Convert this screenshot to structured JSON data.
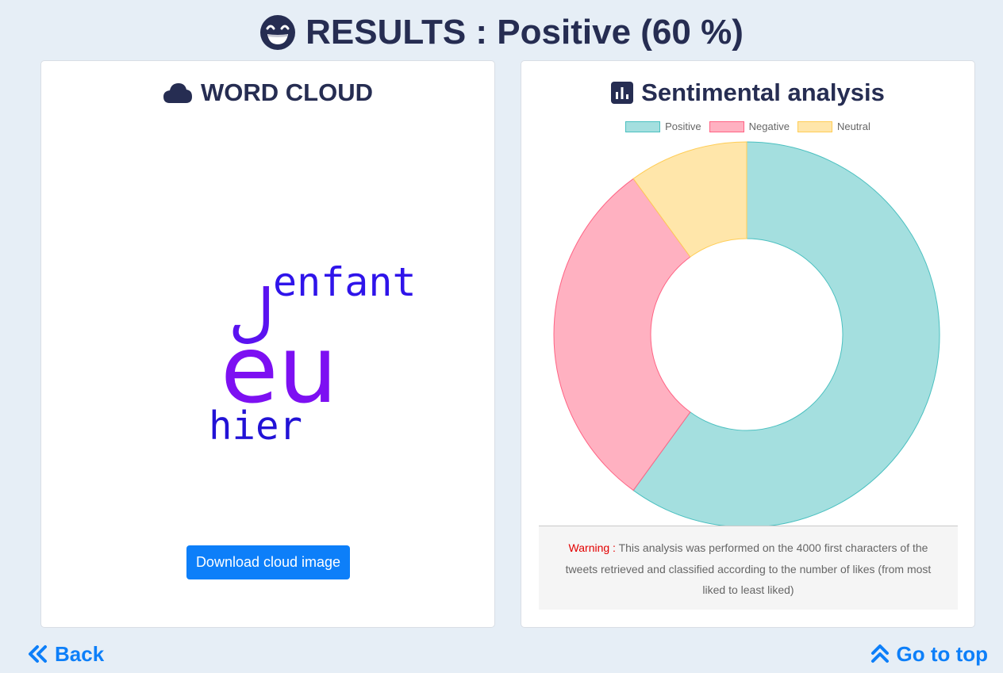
{
  "header": {
    "title": "RESULTS : Positive (60 %)",
    "icon": "grin-beam-icon"
  },
  "word_cloud_card": {
    "title": "WORD CLOUD",
    "icon": "cloud-icon",
    "words": [
      {
        "text": "enfant",
        "color": "#2f14ea"
      },
      {
        "text": "eu",
        "color": "#7d10f2"
      },
      {
        "text": "ﻝ",
        "color": "#5a12f0"
      },
      {
        "text": "hier",
        "color": "#2212d6"
      }
    ],
    "download_label": "Download cloud image"
  },
  "sentiment_card": {
    "title": "Sentimental analysis",
    "icon": "chart-bar-icon",
    "warning_label": "Warning :",
    "warning_text": "This analysis was performed on the 4000 first characters of the tweets retrieved and classified according to the number of likes (from most liked to least liked)"
  },
  "chart_data": {
    "type": "pie",
    "variant": "doughnut",
    "title": "",
    "legend_position": "top",
    "categories": [
      "Positive",
      "Negative",
      "Neutral"
    ],
    "values": [
      60,
      30,
      10
    ],
    "colors": [
      {
        "fill": "#a4dfdf",
        "border": "#4bc0c0"
      },
      {
        "fill": "#ffb1c1",
        "border": "#ff6384"
      },
      {
        "fill": "#ffe6aa",
        "border": "#ffcd56"
      }
    ]
  },
  "footer": {
    "back_label": "Back",
    "top_label": "Go to top"
  }
}
